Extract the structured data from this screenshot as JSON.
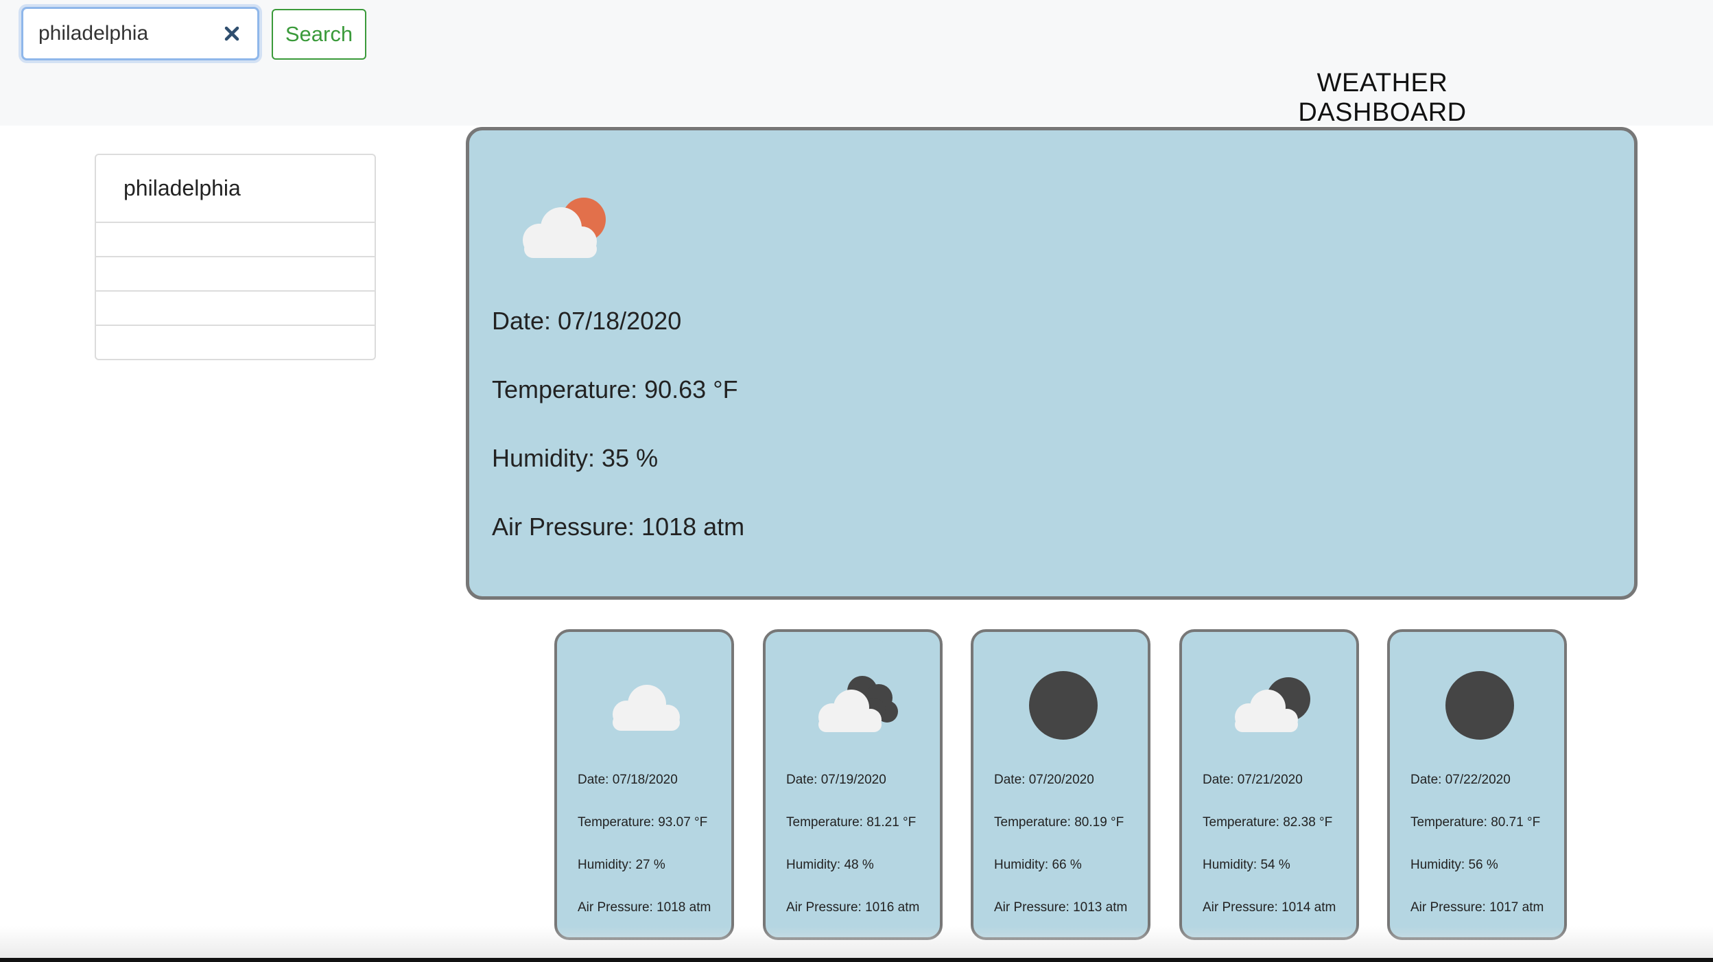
{
  "search": {
    "value": "philadelphia",
    "button_label": "Search"
  },
  "header": {
    "title": "WEATHER DASHBOARD"
  },
  "history": {
    "items": [
      "philadelphia",
      "",
      "",
      "",
      ""
    ]
  },
  "current": {
    "icon": "partly-cloudy-sun-icon",
    "date": "Date: 07/18/2020",
    "temperature": "Temperature: 90.63 °F",
    "humidity": "Humidity: 35 %",
    "pressure": "Air Pressure: 1018 atm"
  },
  "forecast": [
    {
      "icon": "cloud-icon",
      "date": "Date: 07/18/2020",
      "temperature": "Temperature: 93.07 °F",
      "humidity": "Humidity: 27 %",
      "pressure": "Air Pressure: 1018 atm"
    },
    {
      "icon": "cloudy-night-icon",
      "date": "Date: 07/19/2020",
      "temperature": "Temperature: 81.21 °F",
      "humidity": "Humidity: 48 %",
      "pressure": "Air Pressure: 1016 atm"
    },
    {
      "icon": "moon-icon",
      "date": "Date: 07/20/2020",
      "temperature": "Temperature: 80.19 °F",
      "humidity": "Humidity: 66 %",
      "pressure": "Air Pressure: 1013 atm"
    },
    {
      "icon": "partly-cloudy-night-icon",
      "date": "Date: 07/21/2020",
      "temperature": "Temperature: 82.38 °F",
      "humidity": "Humidity: 54 %",
      "pressure": "Air Pressure: 1014 atm"
    },
    {
      "icon": "moon-icon",
      "date": "Date: 07/22/2020",
      "temperature": "Temperature: 80.71 °F",
      "humidity": "Humidity: 56 %",
      "pressure": "Air Pressure: 1017 atm"
    }
  ],
  "colors": {
    "card_background": "#b5d6e2",
    "card_border": "#777777",
    "search_button": "#3a9a3a",
    "sun": "#e2704b",
    "cloud": "#f2f2f2",
    "night_orb": "#454545"
  }
}
